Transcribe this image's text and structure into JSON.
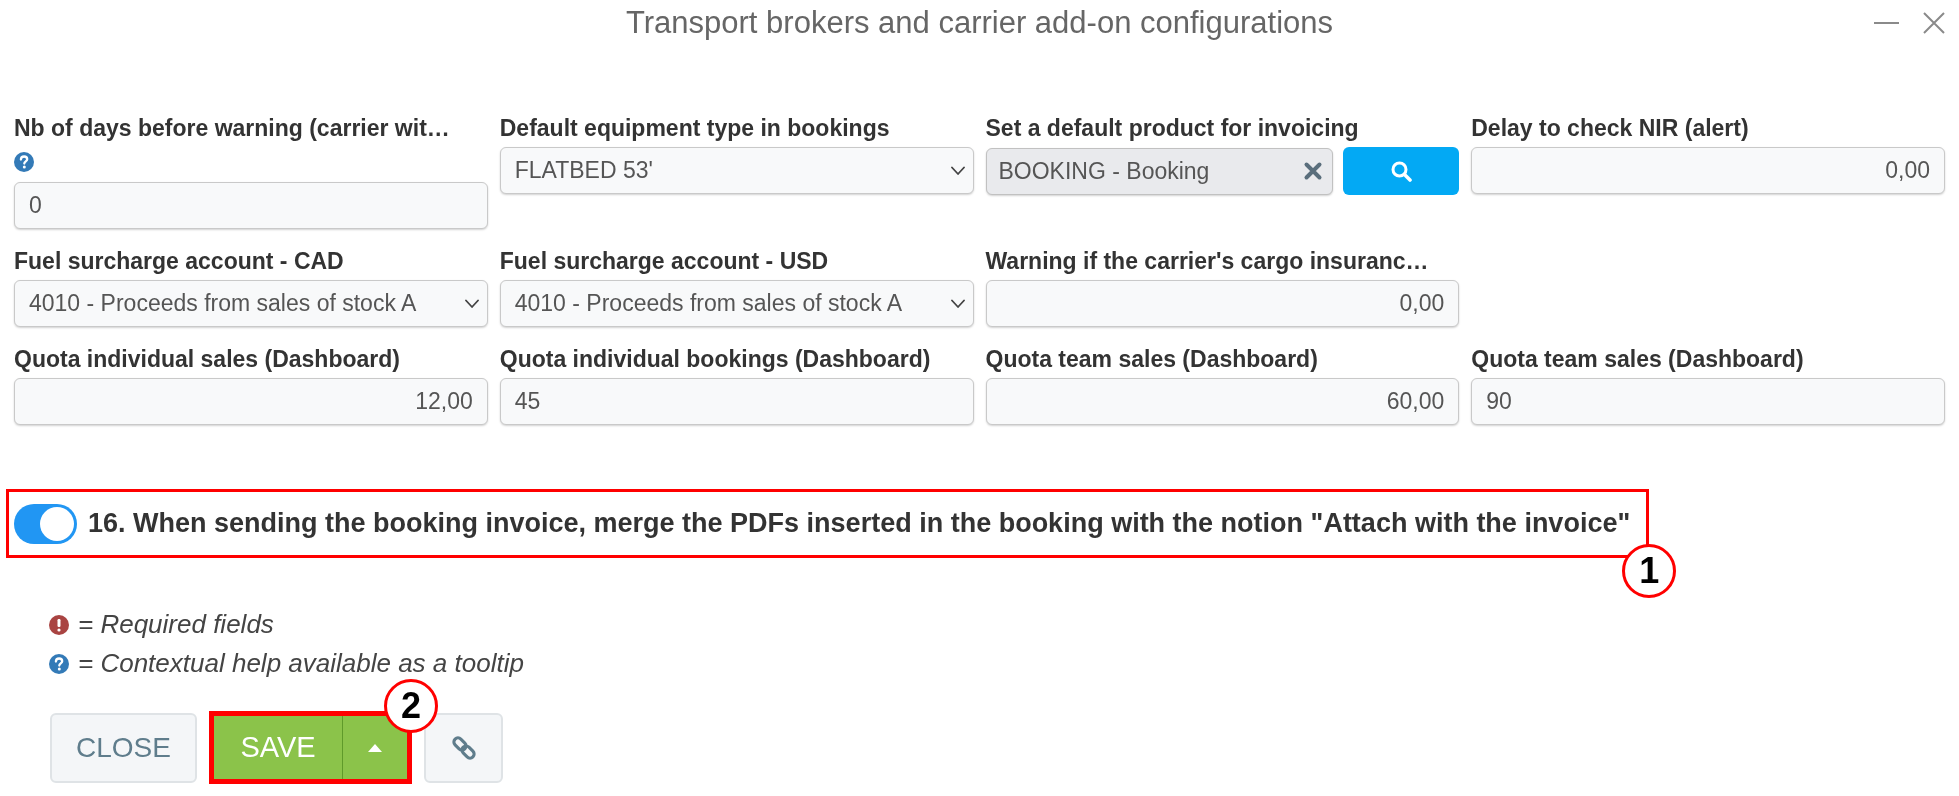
{
  "window": {
    "title": "Transport brokers and carrier add-on configurations"
  },
  "rows": [
    [
      {
        "kind": "integer",
        "label": "Nb of days before warning (carrier wit…",
        "help": true,
        "value": "0"
      },
      {
        "kind": "select",
        "label": "Default equipment type in bookings",
        "help": false,
        "value": "FLATBED 53'"
      },
      {
        "kind": "lookup",
        "label": "Set a default product for invoicing",
        "help": false,
        "value": "BOOKING - Booking"
      },
      {
        "kind": "decimal",
        "label": "Delay to check NIR (alert)",
        "help": false,
        "value": "0,00"
      }
    ],
    [
      {
        "kind": "select",
        "label": "Fuel surcharge account - CAD",
        "help": false,
        "value": "4010 - Proceeds from sales of stock A"
      },
      {
        "kind": "select",
        "label": "Fuel surcharge account - USD",
        "help": false,
        "value": "4010 - Proceeds from sales of stock A"
      },
      {
        "kind": "decimal",
        "label": "Warning if the carrier's cargo insuranc…",
        "help": false,
        "value": "0,00"
      }
    ],
    [
      {
        "kind": "decimal",
        "label": "Quota individual sales (Dashboard)",
        "help": false,
        "value": "12,00"
      },
      {
        "kind": "integer",
        "label": "Quota individual bookings (Dashboard)",
        "help": false,
        "value": "45"
      },
      {
        "kind": "decimal",
        "label": "Quota team sales (Dashboard)",
        "help": false,
        "value": "60,00"
      },
      {
        "kind": "integer",
        "label": "Quota team sales (Dashboard)",
        "help": false,
        "value": "90"
      }
    ]
  ],
  "option": {
    "label": "16. When sending the booking invoice, merge the PDFs inserted in the booking with the notion \"Attach with the invoice\"",
    "on": true,
    "annotation": "1"
  },
  "legend": [
    {
      "kind": "required",
      "text": "= Required fields"
    },
    {
      "kind": "help",
      "text": "= Contextual help available as a tooltip"
    }
  ],
  "actions": [
    {
      "kind": "close",
      "label": "CLOSE"
    },
    {
      "kind": "save",
      "label": "SAVE",
      "annotation": "2"
    },
    {
      "kind": "link"
    }
  ]
}
